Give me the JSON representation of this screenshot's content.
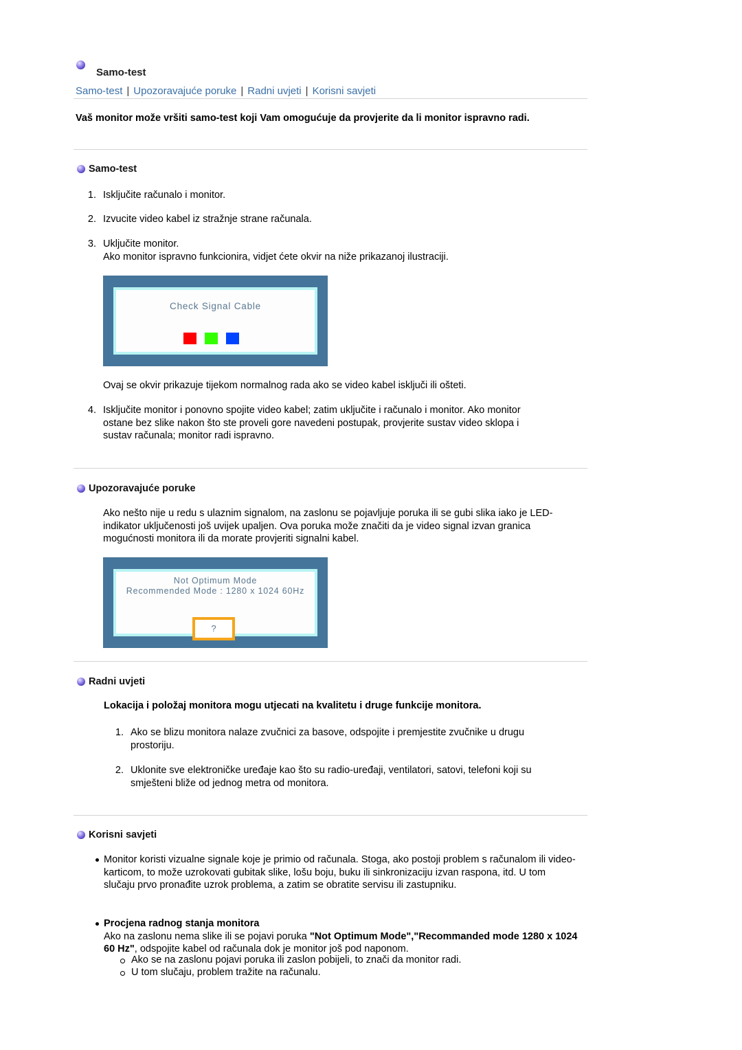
{
  "page": {
    "title": "Samo-test",
    "nav": [
      "Samo-test",
      "Upozoravajuće poruke",
      "Radni uvjeti",
      "Korisni savjeti"
    ],
    "intro": "Vaš monitor može vršiti samo-test koji Vam omogućuje da provjerite da li monitor ispravno radi."
  },
  "self_test": {
    "heading": "Samo-test",
    "steps": [
      {
        "num": "1.",
        "lines": [
          "Isključite računalo i monitor."
        ]
      },
      {
        "num": "2.",
        "lines": [
          "Izvucite video kabel iz stražnje strane računala."
        ]
      },
      {
        "num": "3.",
        "lines": [
          "Uključite monitor.",
          "Ako monitor ispravno funkcionira, vidjet ćete okvir na niže prikazanoj ilustraciji."
        ]
      }
    ],
    "osd1": {
      "text": "Check Signal Cable",
      "colors": [
        "#ff0000",
        "#33ff00",
        "#0044ff"
      ]
    },
    "after_image": "Ovaj se okvir prikazuje tijekom normalnog rada ako se video kabel isključi ili ošteti.",
    "step4": {
      "num": "4.",
      "text": "Isključite monitor i ponovno spojite video kabel; zatim uključite i računalo i monitor. Ako monitor ostane bez slike nakon što ste proveli gore navedeni postupak, provjerite sustav video sklopa i sustav računala; monitor radi ispravno."
    }
  },
  "warnings": {
    "heading": "Upozoravajuće poruke",
    "text": "Ako nešto nije u redu s ulaznim signalom, na zaslonu se pojavljuje poruka ili se gubi slika iako je LED-indikator uključenosti još uvijek upaljen. Ova poruka može značiti da je video signal izvan granica mogućnosti monitora ili da morate provjeriti signalni kabel.",
    "osd2": {
      "line1": "Not Optimum Mode",
      "line2": "Recommended Mode : 1280 x 1024  60Hz",
      "button": "?"
    }
  },
  "environment": {
    "heading": "Radni uvjeti",
    "lead": "Lokacija i položaj monitora mogu utjecati na kvalitetu i druge funkcije monitora.",
    "items": [
      {
        "num": "1.",
        "text": "Ako se blizu monitora nalaze zvučnici za basove, odspojite i premjestite zvučnike u drugu prostoriju."
      },
      {
        "num": "2.",
        "text": "Uklonite sve elektroničke uređaje kao što su radio-uređaji, ventilatori, satovi, telefoni koji su smješteni bliže od jednog metra od monitora."
      }
    ]
  },
  "tips": {
    "heading": "Korisni savjeti",
    "bullet1": "Monitor koristi vizualne signale koje je primio od računala. Stoga, ako postoji problem s računalom ili video-karticom, to može uzrokovati gubitak slike, lošu boju, buku ili sinkronizaciju izvan raspona, itd. U tom slučaju prvo pronađite uzrok problema, a zatim se obratite servisu ili zastupniku.",
    "bullet2_title": "Procjena radnog stanja monitora",
    "bullet2_pre": "Ako na zaslonu nema slike ili se pojavi poruka ",
    "bullet2_bold": "\"Not Optimum Mode\",\"Recommanded mode 1280 x 1024 60 Hz\"",
    "bullet2_post": ", odspojite kabel od računala dok je monitor još pod naponom.",
    "sub": [
      "Ako se na zaslonu pojavi poruka ili zaslon pobijeli, to znači da monitor radi.",
      "U tom slučaju, problem tražite na računalu."
    ]
  }
}
